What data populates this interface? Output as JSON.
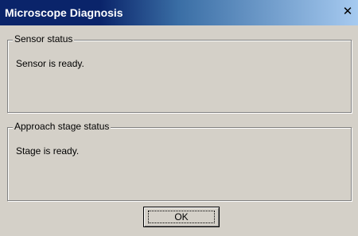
{
  "window": {
    "title": "Microscope Diagnosis",
    "close_glyph": "✕"
  },
  "sensor_group": {
    "label": "Sensor status",
    "text": "Sensor is ready."
  },
  "stage_group": {
    "label": "Approach stage status",
    "text": "Stage is ready."
  },
  "ok_button": {
    "label": "OK"
  }
}
